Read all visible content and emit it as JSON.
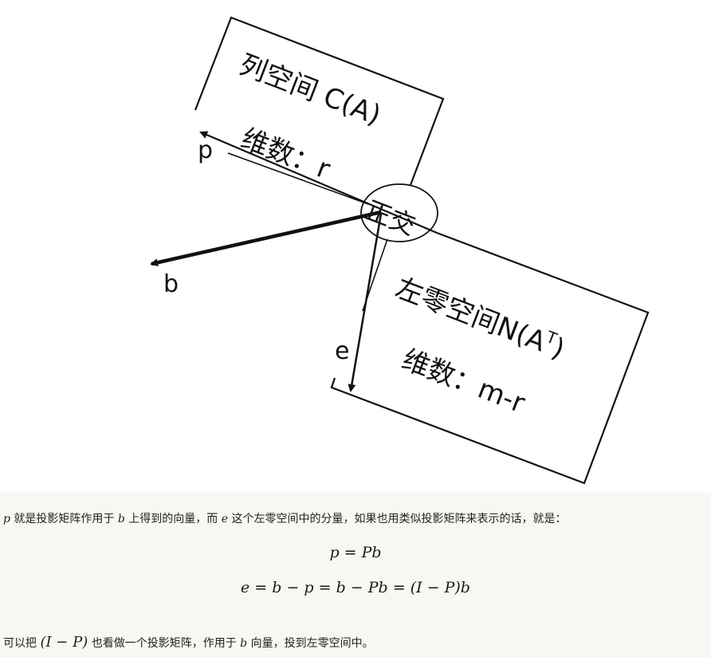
{
  "diagram": {
    "column_space": {
      "title": "列空间 C(A)",
      "dimension": "维数：r"
    },
    "left_null_space": {
      "title": "左零空间N(A",
      "title_superscript": "T",
      "title_close": ")",
      "dimension": "维数：m-r"
    },
    "orthogonal_label": "正交",
    "vectors": {
      "p": "p",
      "b": "b",
      "e": "e"
    }
  },
  "text": {
    "para1": {
      "var_p": "p",
      "part1": " 就是投影矩阵作用于 ",
      "var_b": "b",
      "part2": " 上得到的向量，而 ",
      "var_e": "e",
      "part3": " 这个左零空间中的分量，如果也用类似投影矩阵来表示的话，就是："
    },
    "eq1": "p = Pb",
    "eq2": "e = b − p = b − Pb = (I − P)b",
    "para2": {
      "part1": "可以把 ",
      "expr": "(I − P)",
      "part2": " 也看做一个投影矩阵，作用于 ",
      "var_b": "b",
      "part3": " 向量，投到左零空间中。"
    }
  }
}
